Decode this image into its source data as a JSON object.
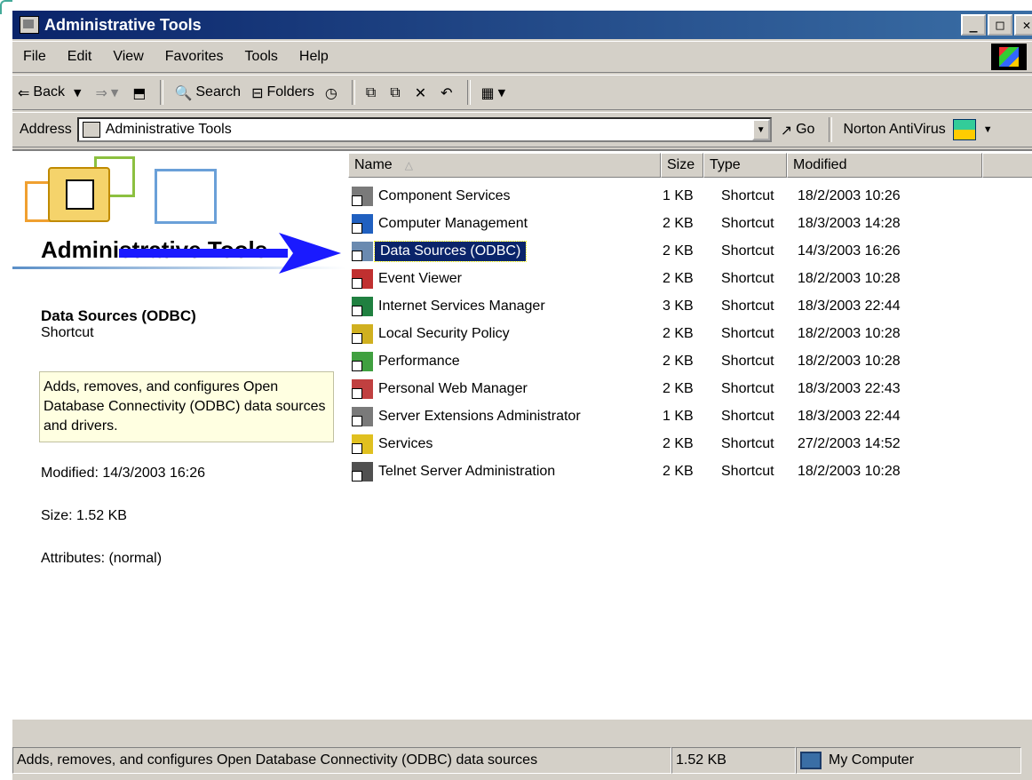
{
  "window": {
    "title": "Administrative Tools",
    "buttons": [
      "_",
      "□",
      "✕"
    ]
  },
  "menu": [
    "File",
    "Edit",
    "View",
    "Favorites",
    "Tools",
    "Help"
  ],
  "toolbar": {
    "back": "Back",
    "search": "Search",
    "folders": "Folders"
  },
  "address": {
    "label": "Address",
    "value": "Administrative Tools",
    "go": "Go",
    "norton": "Norton AntiVirus"
  },
  "left": {
    "title": "Administrative Tools",
    "selected_name": "Data Sources (ODBC)",
    "selected_type": "Shortcut",
    "description": "Adds, removes, and configures Open Database Connectivity (ODBC) data sources and drivers.",
    "modified": "Modified: 14/3/2003 16:26",
    "size": "Size: 1.52 KB",
    "attributes": "Attributes: (normal)"
  },
  "columns": {
    "name": "Name",
    "size": "Size",
    "type": "Type",
    "modified": "Modified"
  },
  "files": [
    {
      "name": "Component Services",
      "size": "1 KB",
      "type": "Shortcut",
      "modified": "18/2/2003 10:26",
      "icon": "component-services-icon",
      "color": "#7a7a7a"
    },
    {
      "name": "Computer Management",
      "size": "2 KB",
      "type": "Shortcut",
      "modified": "18/3/2003 14:28",
      "icon": "computer-management-icon",
      "color": "#2060c0"
    },
    {
      "name": "Data Sources (ODBC)",
      "size": "2 KB",
      "type": "Shortcut",
      "modified": "14/3/2003 16:26",
      "icon": "data-sources-icon",
      "color": "#6a8ab0"
    },
    {
      "name": "Event Viewer",
      "size": "2 KB",
      "type": "Shortcut",
      "modified": "18/2/2003 10:28",
      "icon": "event-viewer-icon",
      "color": "#c03030"
    },
    {
      "name": "Internet Services Manager",
      "size": "3 KB",
      "type": "Shortcut",
      "modified": "18/3/2003 22:44",
      "icon": "internet-services-icon",
      "color": "#208040"
    },
    {
      "name": "Local Security Policy",
      "size": "2 KB",
      "type": "Shortcut",
      "modified": "18/2/2003 10:28",
      "icon": "security-policy-icon",
      "color": "#d0b020"
    },
    {
      "name": "Performance",
      "size": "2 KB",
      "type": "Shortcut",
      "modified": "18/2/2003 10:28",
      "icon": "performance-icon",
      "color": "#40a040"
    },
    {
      "name": "Personal Web Manager",
      "size": "2 KB",
      "type": "Shortcut",
      "modified": "18/3/2003 22:43",
      "icon": "web-manager-icon",
      "color": "#c04040"
    },
    {
      "name": "Server Extensions Administrator",
      "size": "1 KB",
      "type": "Shortcut",
      "modified": "18/3/2003 22:44",
      "icon": "server-extensions-icon",
      "color": "#7a7a7a"
    },
    {
      "name": "Services",
      "size": "2 KB",
      "type": "Shortcut",
      "modified": "27/2/2003 14:52",
      "icon": "services-icon",
      "color": "#e0c020"
    },
    {
      "name": "Telnet Server Administration",
      "size": "2 KB",
      "type": "Shortcut",
      "modified": "18/2/2003 10:28",
      "icon": "telnet-icon",
      "color": "#505050"
    }
  ],
  "selected_index": 2,
  "status": {
    "text": "Adds, removes, and configures Open Database Connectivity (ODBC) data sources",
    "size": "1.52 KB",
    "zone": "My Computer"
  }
}
